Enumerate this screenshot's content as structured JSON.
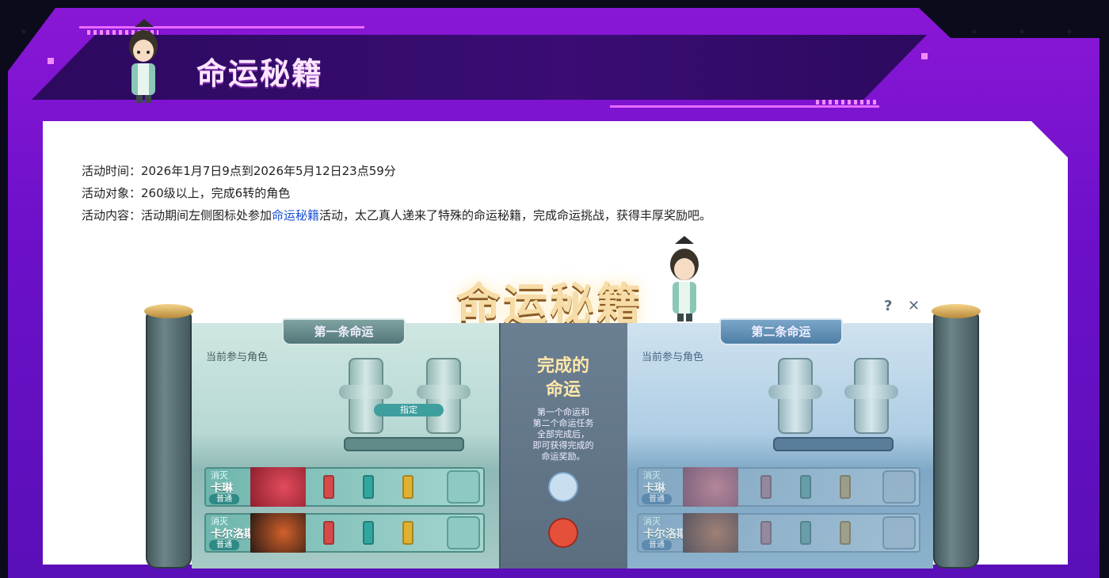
{
  "header": {
    "title": "命运秘籍"
  },
  "info": {
    "time_label": "活动时间：",
    "time_value": "2026年1月7日9点到2026年5月12日23点59分",
    "target_label": "活动对象：",
    "target_value": "260级以上，完成6转的角色",
    "content_label": "活动内容：",
    "content_before": "活动期间左侧图标处参加",
    "content_link": "命运秘籍",
    "content_after": "活动，太乙真人递来了特殊的命运秘籍，完成命运挑战，获得丰厚奖励吧。"
  },
  "game": {
    "title": "命运秘籍",
    "help_icon": "?",
    "close_icon": "✕",
    "tab_first": "第一条命运",
    "tab_second": "第二条命运",
    "current_role_left": "当前参与角色",
    "current_role_right": "当前参与角色",
    "assign_button": "指定",
    "done_title_line1": "完成的",
    "done_title_line2": "命运",
    "done_desc": "第一个命运和\n第二个命运任务\n全部完成后，\n即可获得完成的\n命运奖励。",
    "rows_left": [
      {
        "tag": "消灭",
        "name": "卡琳",
        "grade": "普通"
      },
      {
        "tag": "消灭",
        "name": "卡尔洛斯",
        "grade": "普通"
      }
    ],
    "rows_right": [
      {
        "tag": "消灭",
        "name": "卡琳",
        "grade": "普通"
      },
      {
        "tag": "消灭",
        "name": "卡尔洛斯",
        "grade": "普通"
      }
    ]
  },
  "colors": {
    "frame": "#7a14d0",
    "header_bar": "#33106a",
    "accent": "#e96bff",
    "link": "#1a4fd6"
  }
}
